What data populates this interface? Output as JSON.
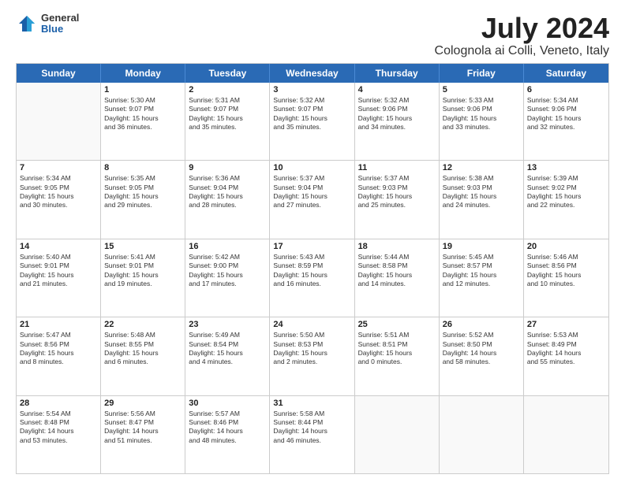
{
  "logo": {
    "general": "General",
    "blue": "Blue"
  },
  "title": "July 2024",
  "subtitle": "Colognola ai Colli, Veneto, Italy",
  "headers": [
    "Sunday",
    "Monday",
    "Tuesday",
    "Wednesday",
    "Thursday",
    "Friday",
    "Saturday"
  ],
  "weeks": [
    [
      {
        "day": "",
        "lines": []
      },
      {
        "day": "1",
        "lines": [
          "Sunrise: 5:30 AM",
          "Sunset: 9:07 PM",
          "Daylight: 15 hours",
          "and 36 minutes."
        ]
      },
      {
        "day": "2",
        "lines": [
          "Sunrise: 5:31 AM",
          "Sunset: 9:07 PM",
          "Daylight: 15 hours",
          "and 35 minutes."
        ]
      },
      {
        "day": "3",
        "lines": [
          "Sunrise: 5:32 AM",
          "Sunset: 9:07 PM",
          "Daylight: 15 hours",
          "and 35 minutes."
        ]
      },
      {
        "day": "4",
        "lines": [
          "Sunrise: 5:32 AM",
          "Sunset: 9:06 PM",
          "Daylight: 15 hours",
          "and 34 minutes."
        ]
      },
      {
        "day": "5",
        "lines": [
          "Sunrise: 5:33 AM",
          "Sunset: 9:06 PM",
          "Daylight: 15 hours",
          "and 33 minutes."
        ]
      },
      {
        "day": "6",
        "lines": [
          "Sunrise: 5:34 AM",
          "Sunset: 9:06 PM",
          "Daylight: 15 hours",
          "and 32 minutes."
        ]
      }
    ],
    [
      {
        "day": "7",
        "lines": [
          "Sunrise: 5:34 AM",
          "Sunset: 9:05 PM",
          "Daylight: 15 hours",
          "and 30 minutes."
        ]
      },
      {
        "day": "8",
        "lines": [
          "Sunrise: 5:35 AM",
          "Sunset: 9:05 PM",
          "Daylight: 15 hours",
          "and 29 minutes."
        ]
      },
      {
        "day": "9",
        "lines": [
          "Sunrise: 5:36 AM",
          "Sunset: 9:04 PM",
          "Daylight: 15 hours",
          "and 28 minutes."
        ]
      },
      {
        "day": "10",
        "lines": [
          "Sunrise: 5:37 AM",
          "Sunset: 9:04 PM",
          "Daylight: 15 hours",
          "and 27 minutes."
        ]
      },
      {
        "day": "11",
        "lines": [
          "Sunrise: 5:37 AM",
          "Sunset: 9:03 PM",
          "Daylight: 15 hours",
          "and 25 minutes."
        ]
      },
      {
        "day": "12",
        "lines": [
          "Sunrise: 5:38 AM",
          "Sunset: 9:03 PM",
          "Daylight: 15 hours",
          "and 24 minutes."
        ]
      },
      {
        "day": "13",
        "lines": [
          "Sunrise: 5:39 AM",
          "Sunset: 9:02 PM",
          "Daylight: 15 hours",
          "and 22 minutes."
        ]
      }
    ],
    [
      {
        "day": "14",
        "lines": [
          "Sunrise: 5:40 AM",
          "Sunset: 9:01 PM",
          "Daylight: 15 hours",
          "and 21 minutes."
        ]
      },
      {
        "day": "15",
        "lines": [
          "Sunrise: 5:41 AM",
          "Sunset: 9:01 PM",
          "Daylight: 15 hours",
          "and 19 minutes."
        ]
      },
      {
        "day": "16",
        "lines": [
          "Sunrise: 5:42 AM",
          "Sunset: 9:00 PM",
          "Daylight: 15 hours",
          "and 17 minutes."
        ]
      },
      {
        "day": "17",
        "lines": [
          "Sunrise: 5:43 AM",
          "Sunset: 8:59 PM",
          "Daylight: 15 hours",
          "and 16 minutes."
        ]
      },
      {
        "day": "18",
        "lines": [
          "Sunrise: 5:44 AM",
          "Sunset: 8:58 PM",
          "Daylight: 15 hours",
          "and 14 minutes."
        ]
      },
      {
        "day": "19",
        "lines": [
          "Sunrise: 5:45 AM",
          "Sunset: 8:57 PM",
          "Daylight: 15 hours",
          "and 12 minutes."
        ]
      },
      {
        "day": "20",
        "lines": [
          "Sunrise: 5:46 AM",
          "Sunset: 8:56 PM",
          "Daylight: 15 hours",
          "and 10 minutes."
        ]
      }
    ],
    [
      {
        "day": "21",
        "lines": [
          "Sunrise: 5:47 AM",
          "Sunset: 8:56 PM",
          "Daylight: 15 hours",
          "and 8 minutes."
        ]
      },
      {
        "day": "22",
        "lines": [
          "Sunrise: 5:48 AM",
          "Sunset: 8:55 PM",
          "Daylight: 15 hours",
          "and 6 minutes."
        ]
      },
      {
        "day": "23",
        "lines": [
          "Sunrise: 5:49 AM",
          "Sunset: 8:54 PM",
          "Daylight: 15 hours",
          "and 4 minutes."
        ]
      },
      {
        "day": "24",
        "lines": [
          "Sunrise: 5:50 AM",
          "Sunset: 8:53 PM",
          "Daylight: 15 hours",
          "and 2 minutes."
        ]
      },
      {
        "day": "25",
        "lines": [
          "Sunrise: 5:51 AM",
          "Sunset: 8:51 PM",
          "Daylight: 15 hours",
          "and 0 minutes."
        ]
      },
      {
        "day": "26",
        "lines": [
          "Sunrise: 5:52 AM",
          "Sunset: 8:50 PM",
          "Daylight: 14 hours",
          "and 58 minutes."
        ]
      },
      {
        "day": "27",
        "lines": [
          "Sunrise: 5:53 AM",
          "Sunset: 8:49 PM",
          "Daylight: 14 hours",
          "and 55 minutes."
        ]
      }
    ],
    [
      {
        "day": "28",
        "lines": [
          "Sunrise: 5:54 AM",
          "Sunset: 8:48 PM",
          "Daylight: 14 hours",
          "and 53 minutes."
        ]
      },
      {
        "day": "29",
        "lines": [
          "Sunrise: 5:56 AM",
          "Sunset: 8:47 PM",
          "Daylight: 14 hours",
          "and 51 minutes."
        ]
      },
      {
        "day": "30",
        "lines": [
          "Sunrise: 5:57 AM",
          "Sunset: 8:46 PM",
          "Daylight: 14 hours",
          "and 48 minutes."
        ]
      },
      {
        "day": "31",
        "lines": [
          "Sunrise: 5:58 AM",
          "Sunset: 8:44 PM",
          "Daylight: 14 hours",
          "and 46 minutes."
        ]
      },
      {
        "day": "",
        "lines": []
      },
      {
        "day": "",
        "lines": []
      },
      {
        "day": "",
        "lines": []
      }
    ]
  ]
}
